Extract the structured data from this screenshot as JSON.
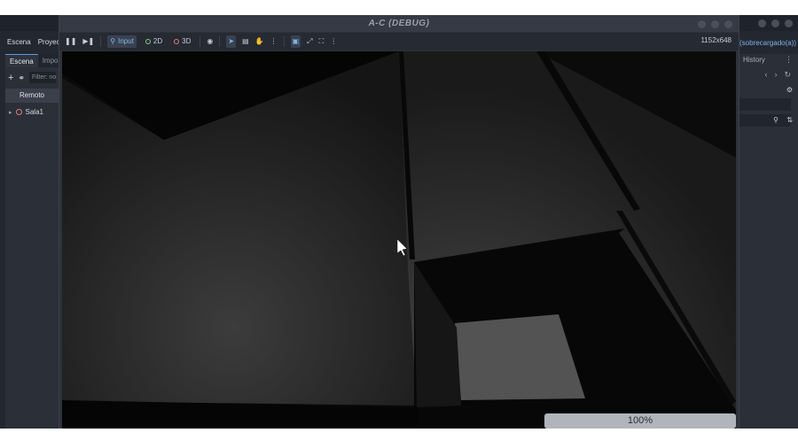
{
  "editor": {
    "menu": [
      "Escena",
      "Proyecto"
    ],
    "right_overflow_text": "(sobrecargado(a))"
  },
  "scene_dock": {
    "tabs": [
      "Escena",
      "Importar"
    ],
    "filter_placeholder": "Filter: nodes",
    "remote_label": "Remoto",
    "tree": [
      {
        "label": "Sala1"
      }
    ]
  },
  "right_dock": {
    "title": "History"
  },
  "game_window": {
    "title": "A-C (DEBUG)",
    "toolbar": {
      "input_label": "Input",
      "mode_2d": "2D",
      "mode_3d": "3D"
    },
    "resolution": "1152x648",
    "zoom": "100%"
  },
  "colors": {
    "editor_bg": "#232730",
    "accent": "#7fb8ee",
    "icon_2d": "#7fd18a",
    "icon_3d": "#e77b7b"
  },
  "icons": [
    "pause-icon",
    "step-icon",
    "input-icon",
    "eye-icon",
    "select-icon",
    "list-select-icon",
    "hand-icon",
    "more-icon",
    "focus-icon",
    "expand-icon",
    "fullscreen-icon",
    "search-icon",
    "sort-icon",
    "plus-icon",
    "link-icon"
  ]
}
